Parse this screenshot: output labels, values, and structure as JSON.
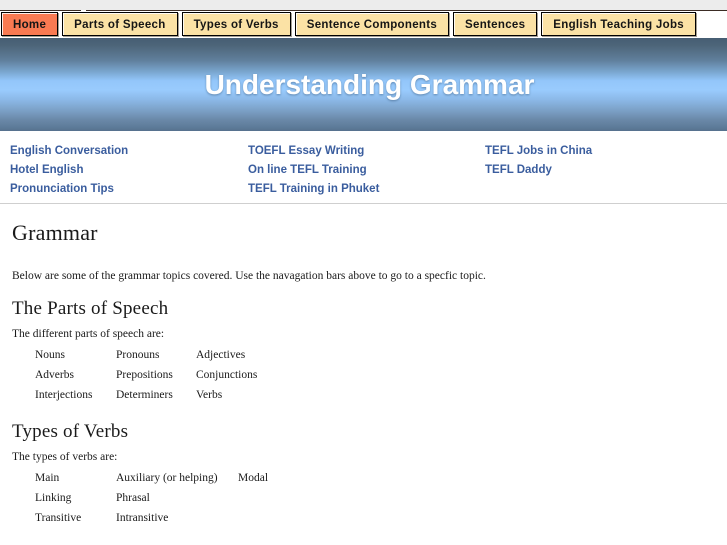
{
  "colors": {
    "active_tab": "#f97a52",
    "inactive_tab": "#fbe2a5",
    "link": "#3a5d9e",
    "banner_top": "#465d73",
    "banner_mid": "#99cbfd",
    "banner_bottom": "#56718d",
    "top_strip": "#ececec"
  },
  "nav": {
    "tabs": [
      {
        "label": "Home",
        "active": true
      },
      {
        "label": "Parts of Speech",
        "active": false
      },
      {
        "label": "Types of Verbs",
        "active": false
      },
      {
        "label": "Sentence Components",
        "active": false
      },
      {
        "label": "Sentences",
        "active": false
      },
      {
        "label": "English Teaching Jobs",
        "active": false
      }
    ]
  },
  "banner": {
    "title": "Understanding Grammar"
  },
  "links": {
    "columns": [
      {
        "items": [
          {
            "label": "English Conversation"
          },
          {
            "label": "Hotel English"
          },
          {
            "label": "Pronunciation Tips"
          }
        ]
      },
      {
        "items": [
          {
            "label": "TOEFL Essay Writing"
          },
          {
            "label": "On line TEFL Training"
          },
          {
            "label": "TEFL Training in Phuket"
          }
        ]
      },
      {
        "items": [
          {
            "label": "TEFL Jobs in China"
          },
          {
            "label": "TEFL Daddy"
          }
        ]
      }
    ]
  },
  "content": {
    "page_title": "Grammar",
    "intro": "Below are some of the grammar topics covered. Use the navagation bars above to go to a specfic topic.",
    "sections": [
      {
        "title": "The Parts of Speech",
        "lead": "The different parts of speech are:",
        "rows": [
          [
            "Nouns",
            "Pronouns",
            "Adjectives"
          ],
          [
            "Adverbs",
            "Prepositions",
            "Conjunctions"
          ],
          [
            "Interjections",
            "Determiners",
            "Verbs"
          ]
        ]
      },
      {
        "title": "Types of Verbs",
        "lead": "The types of verbs are:",
        "rows": [
          [
            "Main",
            "Auxiliary (or helping)",
            "Modal"
          ],
          [
            "Linking",
            "Phrasal",
            ""
          ],
          [
            "Transitive",
            "Intransitive",
            ""
          ]
        ]
      }
    ]
  }
}
